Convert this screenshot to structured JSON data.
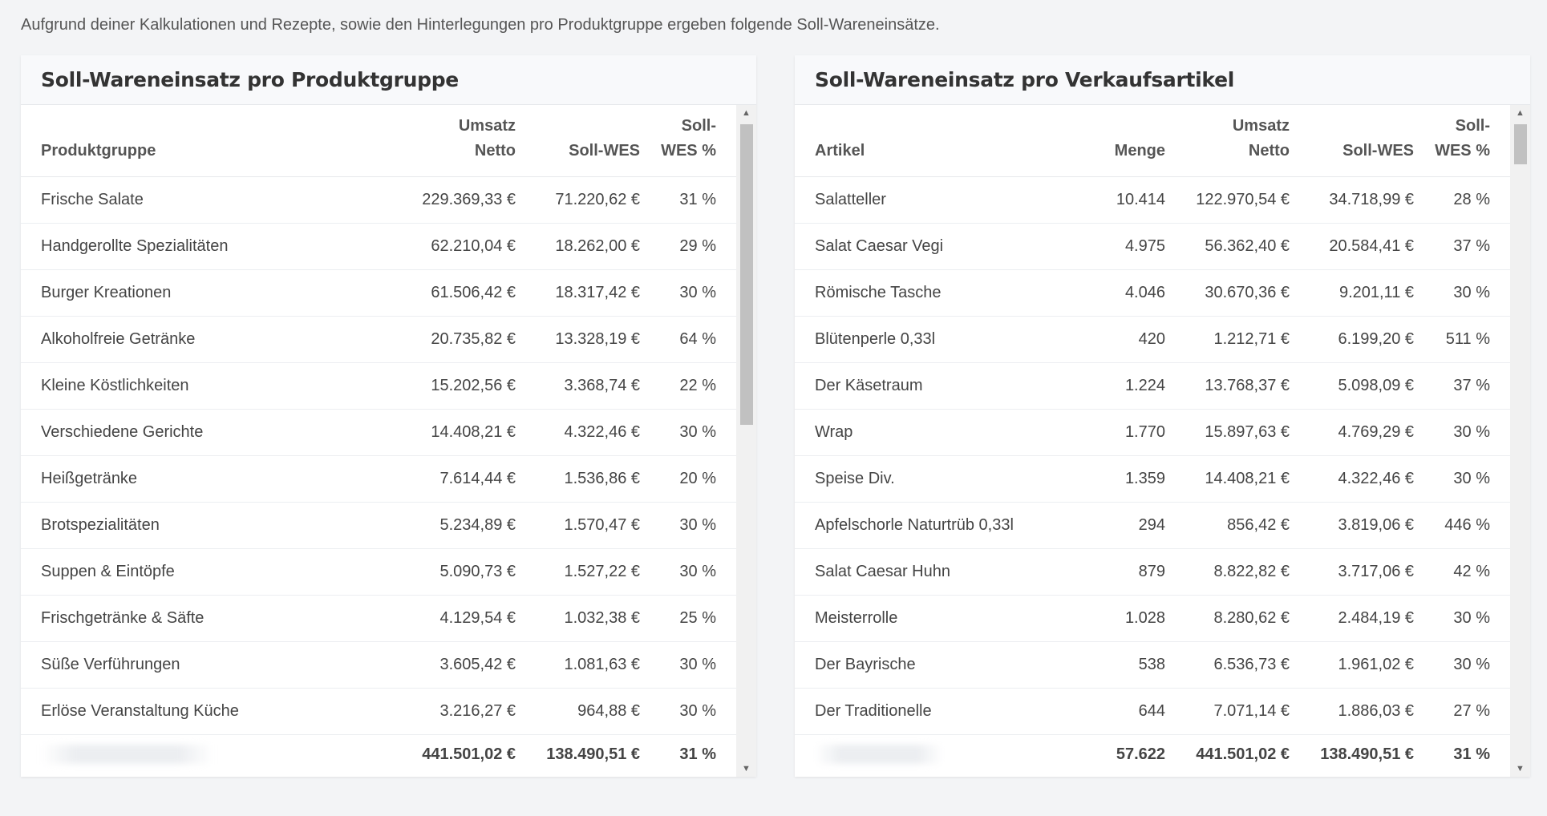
{
  "intro": "Aufgrund deiner Kalkulationen und Rezepte, sowie den Hinterlegungen pro Produktgruppe ergeben folgende Soll-Wareneinsätze.",
  "left": {
    "title": "Soll-Wareneinsatz pro Produktgruppe",
    "headers": {
      "col1": "Produktgruppe",
      "col2a": "Umsatz",
      "col2b": "Netto",
      "col3": "Soll-WES",
      "col4a": "Soll-",
      "col4b": "WES %"
    },
    "rows": [
      {
        "name": "Frische Salate",
        "umsatz": "229.369,33 €",
        "wes": "71.220,62 €",
        "pct": "31 %"
      },
      {
        "name": "Handgerollte Spezialitäten",
        "umsatz": "62.210,04 €",
        "wes": "18.262,00 €",
        "pct": "29 %"
      },
      {
        "name": "Burger Kreationen",
        "umsatz": "61.506,42 €",
        "wes": "18.317,42 €",
        "pct": "30 %"
      },
      {
        "name": "Alkoholfreie Getränke",
        "umsatz": "20.735,82 €",
        "wes": "13.328,19 €",
        "pct": "64 %"
      },
      {
        "name": "Kleine Köstlichkeiten",
        "umsatz": "15.202,56 €",
        "wes": "3.368,74 €",
        "pct": "22 %"
      },
      {
        "name": "Verschiedene Gerichte",
        "umsatz": "14.408,21 €",
        "wes": "4.322,46 €",
        "pct": "30 %"
      },
      {
        "name": "Heißgetränke",
        "umsatz": "7.614,44 €",
        "wes": "1.536,86 €",
        "pct": "20 %"
      },
      {
        "name": "Brotspezialitäten",
        "umsatz": "5.234,89 €",
        "wes": "1.570,47 €",
        "pct": "30 %"
      },
      {
        "name": "Suppen & Eintöpfe",
        "umsatz": "5.090,73 €",
        "wes": "1.527,22 €",
        "pct": "30 %"
      },
      {
        "name": "Frischgetränke & Säfte",
        "umsatz": "4.129,54 €",
        "wes": "1.032,38 €",
        "pct": "25 %"
      },
      {
        "name": "Süße Verführungen",
        "umsatz": "3.605,42 €",
        "wes": "1.081,63 €",
        "pct": "30 %"
      },
      {
        "name": "Erlöse Veranstaltung Küche",
        "umsatz": "3.216,27 €",
        "wes": "964,88 €",
        "pct": "30 %"
      }
    ],
    "totals": {
      "umsatz": "441.501,02 €",
      "wes": "138.490,51 €",
      "pct": "31 %"
    }
  },
  "right": {
    "title": "Soll-Wareneinsatz pro Verkaufsartikel",
    "headers": {
      "col1": "Artikel",
      "col2": "Menge",
      "col3a": "Umsatz",
      "col3b": "Netto",
      "col4": "Soll-WES",
      "col5a": "Soll-",
      "col5b": "WES %"
    },
    "rows": [
      {
        "name": "Salatteller",
        "menge": "10.414",
        "umsatz": "122.970,54 €",
        "wes": "34.718,99 €",
        "pct": "28 %"
      },
      {
        "name": "Salat Caesar Vegi",
        "menge": "4.975",
        "umsatz": "56.362,40 €",
        "wes": "20.584,41 €",
        "pct": "37 %"
      },
      {
        "name": "Römische Tasche",
        "menge": "4.046",
        "umsatz": "30.670,36 €",
        "wes": "9.201,11 €",
        "pct": "30 %"
      },
      {
        "name": "Blütenperle 0,33l",
        "menge": "420",
        "umsatz": "1.212,71 €",
        "wes": "6.199,20 €",
        "pct": "511 %"
      },
      {
        "name": "Der Käsetraum",
        "menge": "1.224",
        "umsatz": "13.768,37 €",
        "wes": "5.098,09 €",
        "pct": "37 %"
      },
      {
        "name": "Wrap",
        "menge": "1.770",
        "umsatz": "15.897,63 €",
        "wes": "4.769,29 €",
        "pct": "30 %"
      },
      {
        "name": "Speise Div.",
        "menge": "1.359",
        "umsatz": "14.408,21 €",
        "wes": "4.322,46 €",
        "pct": "30 %"
      },
      {
        "name": "Apfelschorle Naturtrüb 0,33l",
        "menge": "294",
        "umsatz": "856,42 €",
        "wes": "3.819,06 €",
        "pct": "446 %"
      },
      {
        "name": "Salat Caesar Huhn",
        "menge": "879",
        "umsatz": "8.822,82 €",
        "wes": "3.717,06 €",
        "pct": "42 %"
      },
      {
        "name": "Meisterrolle",
        "menge": "1.028",
        "umsatz": "8.280,62 €",
        "wes": "2.484,19 €",
        "pct": "30 %"
      },
      {
        "name": "Der Bayrische",
        "menge": "538",
        "umsatz": "6.536,73 €",
        "wes": "1.961,02 €",
        "pct": "30 %"
      },
      {
        "name": "Der Traditionelle",
        "menge": "644",
        "umsatz": "7.071,14 €",
        "wes": "1.886,03 €",
        "pct": "27 %"
      }
    ],
    "totals": {
      "menge": "57.622",
      "umsatz": "441.501,02 €",
      "wes": "138.490,51 €",
      "pct": "31 %"
    }
  },
  "icons": {
    "scroll_up": "▲",
    "scroll_down": "▼"
  }
}
